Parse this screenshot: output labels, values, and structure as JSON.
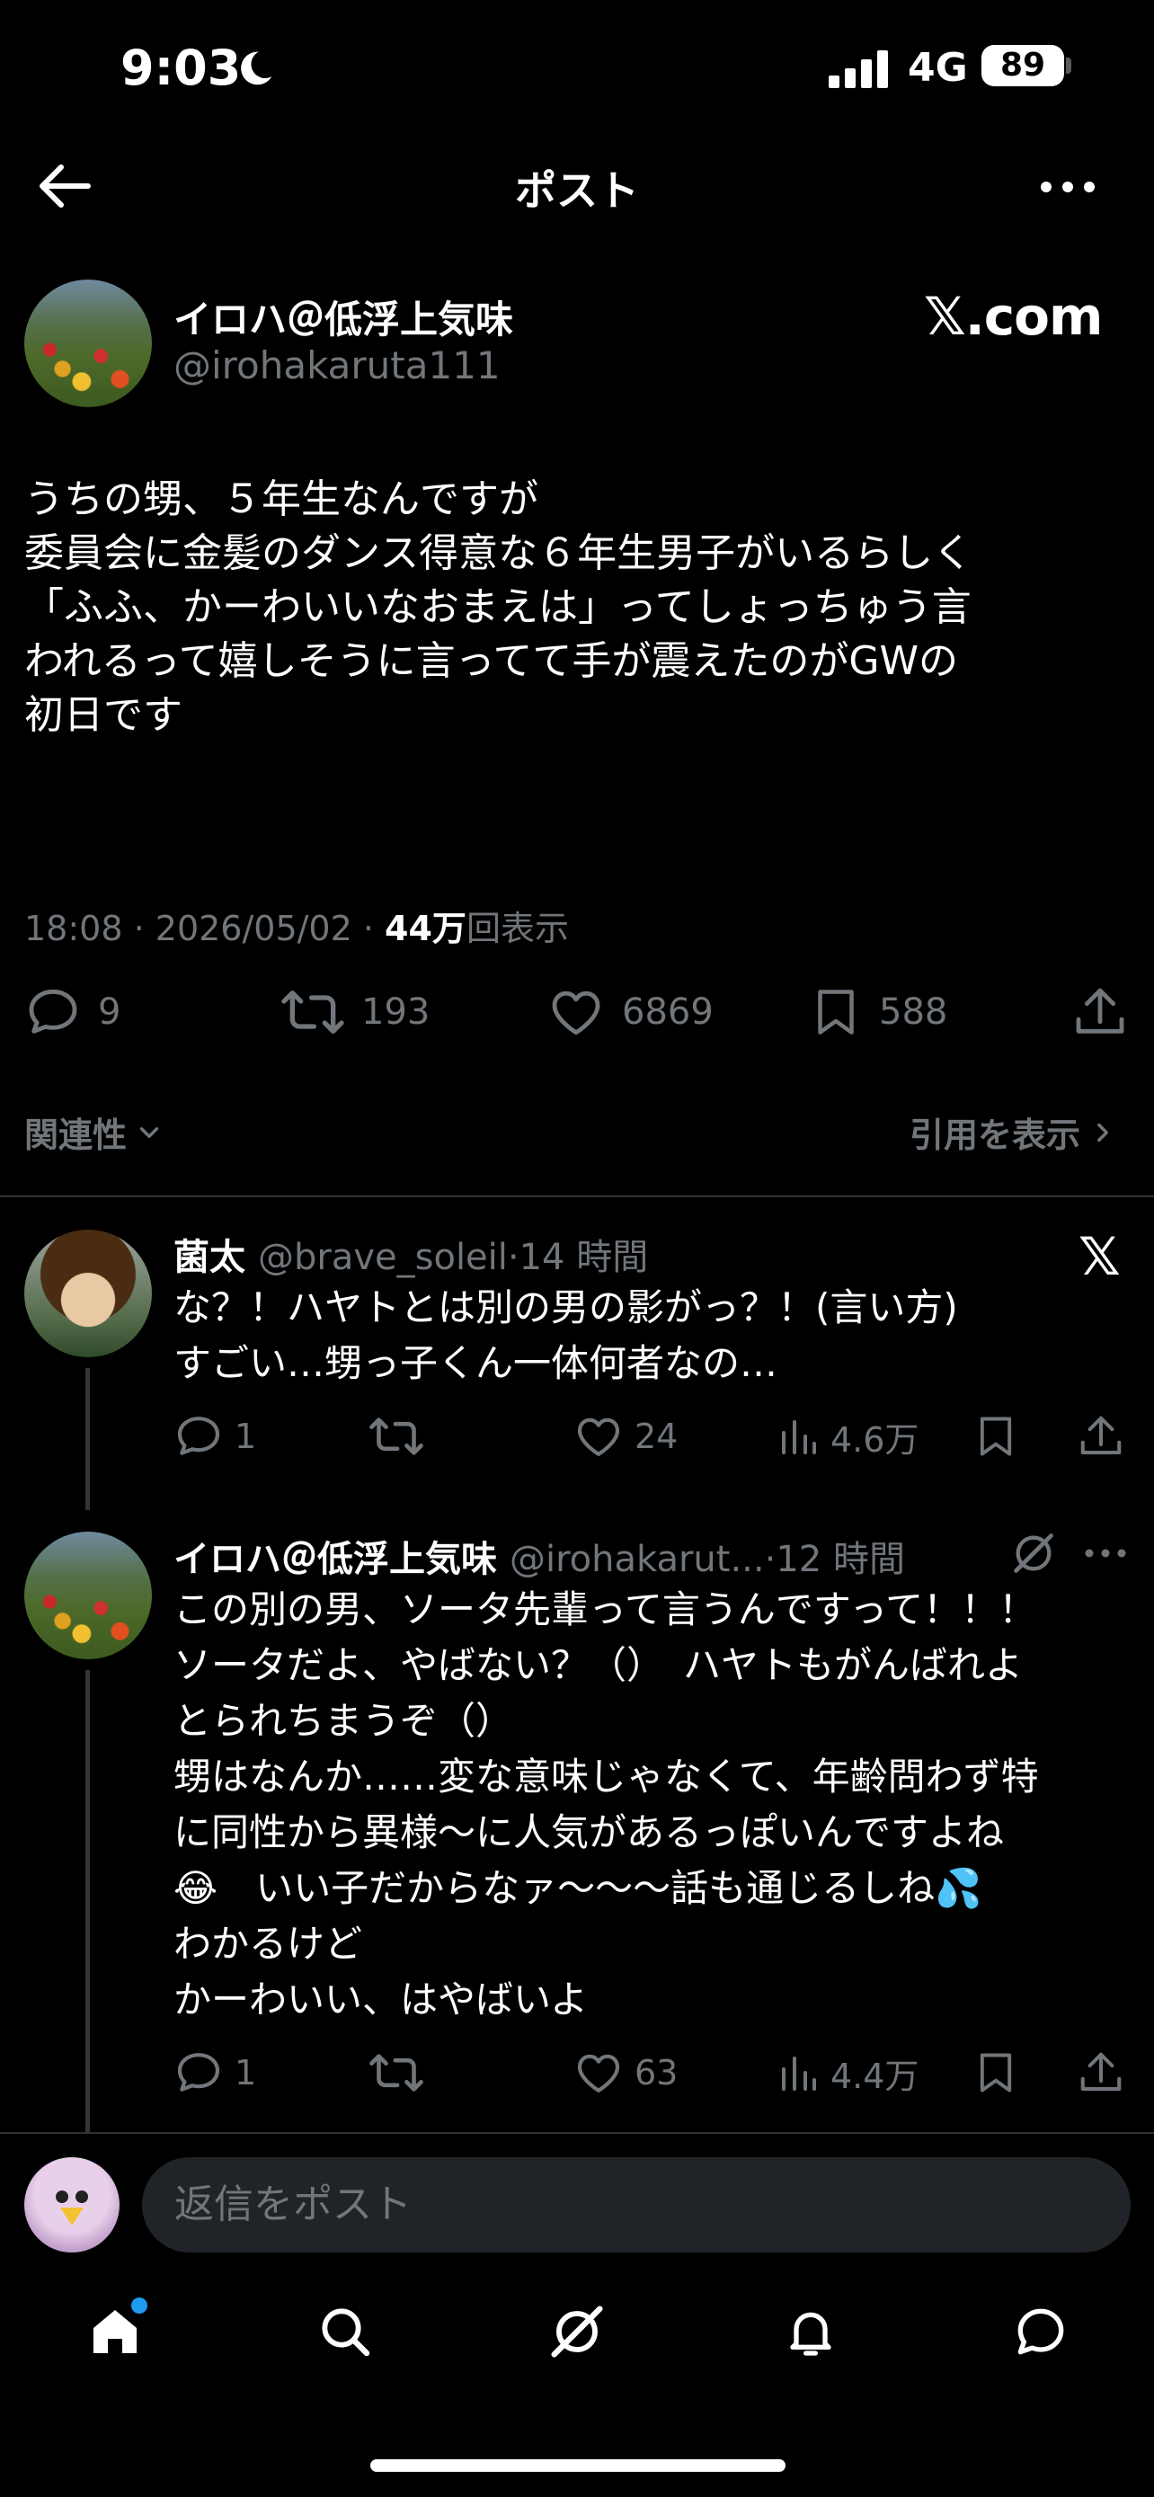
{
  "status_bar": {
    "time": "9:03",
    "network": "4G",
    "battery": "89"
  },
  "header": {
    "title": "ポスト"
  },
  "main_post": {
    "author_name": "イロハ＠低浮上気味",
    "handle": "@irohakaruta111",
    "source_logo": "𝕏.com",
    "body_lines": [
      "うちの甥、５年生なんですが",
      "委員会に金髪のダンス得意な６年生男子がいるらしく",
      "「ふふ、かーわいいなおまえは」ってしょっちゅう言",
      "われるって嬉しそうに言ってて手が震えたのがGWの",
      "初日です"
    ],
    "time": "18:08",
    "date": "2026/05/02",
    "views_count": "44万",
    "views_label": "回表示",
    "replies": "9",
    "reposts": "193",
    "likes": "6869",
    "bookmarks": "588"
  },
  "sort": {
    "relevance_label": "関連性",
    "quotes_label": "引用を表示"
  },
  "replies": [
    {
      "name": "菌太",
      "handle": "@brave_soleil",
      "time": "14 時間",
      "lines": [
        "な？！ハヤトとは別の男の影がっ？！(言い方)",
        "すごい…甥っ子くん一体何者なの…"
      ],
      "replies": "1",
      "likes": "24",
      "views": "4.6万"
    },
    {
      "name": "イロハ＠低浮上気味",
      "handle": "@irohakarut...",
      "time": "12 時間",
      "lines": [
        "この別の男、ソータ先輩って言うんですって！！！",
        "ソータだよ、やばない？（）　ハヤトもがんばれよ",
        "とられちまうぞ（）",
        "甥はなんか……変な意味じゃなくて、年齢問わず特",
        "に同性から異様〜に人気があるっぽいんですよね",
        "😂　いい子だからなァ〜〜〜話も通じるしね💦",
        "わかるけど",
        "かーわいい、はやばいよ"
      ],
      "replies": "1",
      "likes": "63",
      "views": "4.4万"
    }
  ],
  "composer": {
    "placeholder": "返信をポスト"
  },
  "icons": {
    "back": "arrow-left-icon",
    "more": "more-horizontal-icon",
    "reply": "speech-bubble-icon",
    "repost": "repost-icon",
    "like": "heart-icon",
    "bookmark": "bookmark-icon",
    "share": "share-icon",
    "views": "bar-chart-icon",
    "grok": "grok-icon",
    "home": "home-icon",
    "search": "search-icon",
    "notifications": "bell-icon",
    "messages": "message-icon"
  },
  "colors": {
    "background": "#000000",
    "text": "#e7e9ea",
    "muted": "#71767b",
    "accent": "#1d9bf0"
  }
}
